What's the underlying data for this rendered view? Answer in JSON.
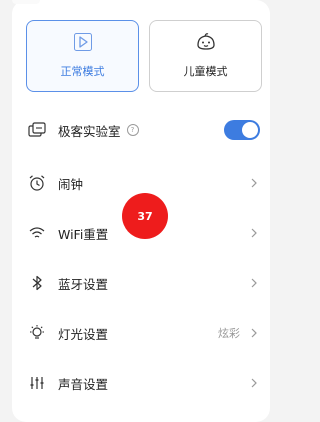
{
  "modes": {
    "normal_label": "正常模式",
    "kids_label": "儿童模式"
  },
  "settings": [
    {
      "label": "极客实验室",
      "icon": "lab-icon",
      "help": "?",
      "toggle_on": true
    },
    {
      "label": "闹钟",
      "icon": "alarm-clock-icon"
    },
    {
      "label": "WiFi重置",
      "icon": "wifi-icon"
    },
    {
      "label": "蓝牙设置",
      "icon": "bluetooth-icon"
    },
    {
      "label": "灯光设置",
      "icon": "light-bulb-icon",
      "value": "炫彩"
    },
    {
      "label": "声音设置",
      "icon": "equalizer-icon"
    }
  ],
  "badge": {
    "count": "37"
  },
  "colors": {
    "accent": "#3d7ce0",
    "badge": "#ee1c1c"
  }
}
